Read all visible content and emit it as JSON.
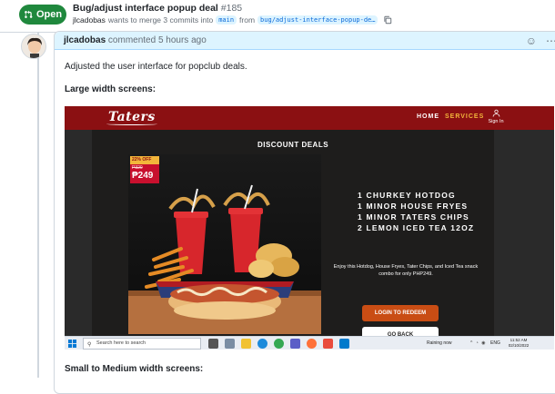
{
  "pr": {
    "status": "Open",
    "title": "Bug/adjust interface popup deal",
    "number": "#185",
    "author": "jlcadobas",
    "merge_text": "wants to merge 3 commits into",
    "base_branch": "main",
    "from_text": "from",
    "head_branch": "bug/adjust-interface-popup-de…"
  },
  "comment": {
    "author": "jlcadobas",
    "time": "commented 5 hours ago",
    "body": "Adjusted the user interface for popclub deals.",
    "large_heading": "Large width screens:",
    "small_heading": "Small to Medium width screens:"
  },
  "screenshot": {
    "logo": "Taters",
    "nav": {
      "home": "HOME",
      "services": "SERVICES",
      "signin": "Sign In"
    },
    "deals_title": "DISCOUNT DEALS",
    "price": {
      "off": "22% OFF",
      "old": "P320",
      "new": "₱249"
    },
    "items": [
      "1 CHURKEY HOTDOG",
      "1 MINOR HOUSE FRYES",
      "1 MINOR TATERS CHIPS",
      "2 LEMON ICED TEA 12OZ"
    ],
    "description": "Enjoy this Hotdog, House Fryes, Tater Chips, and Iced Tea snack combo for only PHP249.",
    "login_button": "LOGIN TO REDEEM",
    "back_button": "GO BACK",
    "taskbar": {
      "search_placeholder": "Search here to search",
      "weather": "Raining now",
      "lang": "ENG",
      "time": "11:52 AM",
      "date": "02/10/2022"
    }
  },
  "colors": {
    "open_green": "#1f883d",
    "header_blue": "#ddf4ff",
    "taters_red": "#8b1012",
    "accent_orange": "#c94d14",
    "gold": "#f3b63b"
  }
}
